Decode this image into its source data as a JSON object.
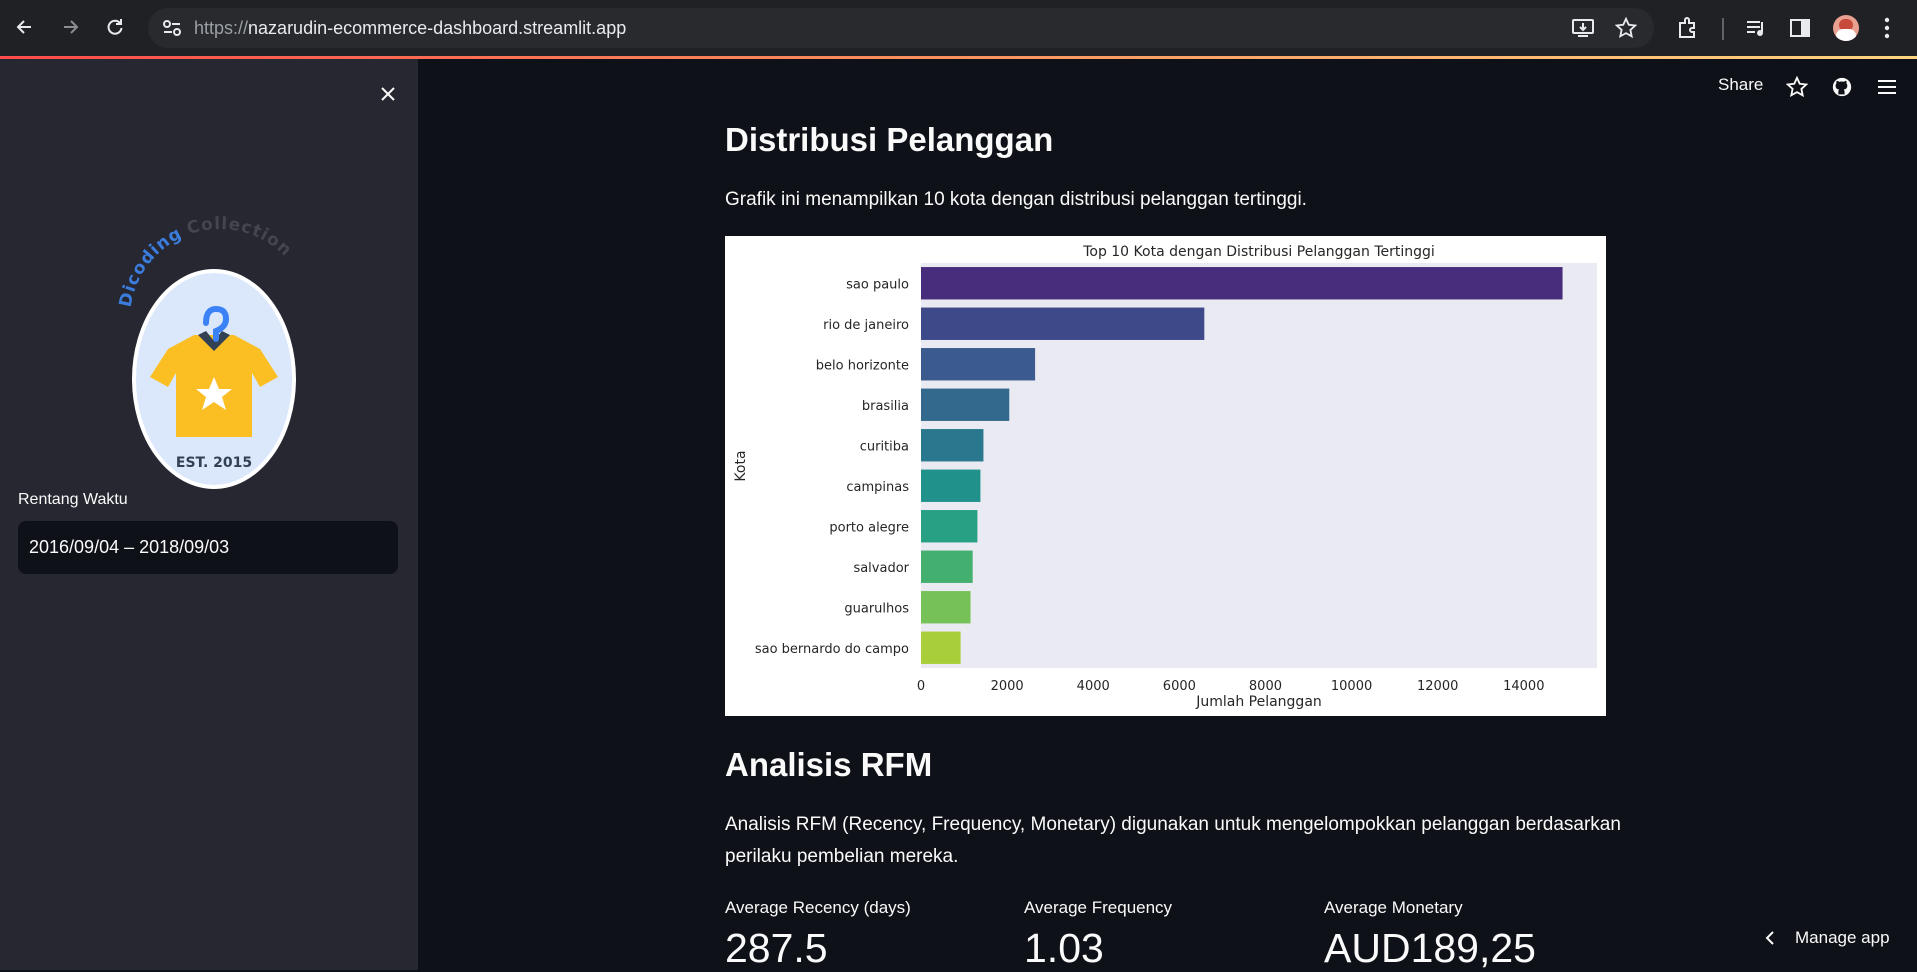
{
  "browser": {
    "url_scheme": "https://",
    "url_host": "nazarudin-ecommerce-dashboard.streamlit.app"
  },
  "sidebar": {
    "logo": {
      "arc_left": "Dicoding",
      "arc_right": "Collection",
      "est": "EST. 2015"
    },
    "date_label": "Rentang Waktu",
    "date_value": "2016/09/04 – 2018/09/03"
  },
  "header": {
    "share_label": "Share"
  },
  "section1": {
    "title": "Distribusi Pelanggan",
    "description": "Grafik ini menampilkan 10 kota dengan distribusi pelanggan tertinggi."
  },
  "chart_data": {
    "type": "bar",
    "orientation": "horizontal",
    "title": "Top 10 Kota dengan Distribusi Pelanggan Tertinggi",
    "xlabel": "Jumlah Pelanggan",
    "ylabel": "Kota",
    "categories": [
      "sao paulo",
      "rio de janeiro",
      "belo horizonte",
      "brasilia",
      "curitiba",
      "campinas",
      "porto alegre",
      "salvador",
      "guarulhos",
      "sao bernardo do campo"
    ],
    "values": [
      14900,
      6580,
      2650,
      2050,
      1450,
      1380,
      1310,
      1200,
      1150,
      920
    ],
    "xlim": [
      0,
      15700
    ],
    "xticks": [
      0,
      2000,
      4000,
      6000,
      8000,
      10000,
      12000,
      14000
    ],
    "colors": [
      "#472d7b",
      "#3e4989",
      "#3b5a8e",
      "#33698d",
      "#2a788e",
      "#21918c",
      "#27a083",
      "#44b06f",
      "#77c258",
      "#a8cf3a"
    ],
    "plot_background": "#eaeaf2",
    "grid": false
  },
  "section2": {
    "title": "Analisis RFM",
    "description_line1": "Analisis RFM (Recency, Frequency, Monetary) digunakan untuk mengelompokkan pelanggan berdasarkan",
    "description_line2": "perilaku pembelian mereka."
  },
  "metrics": [
    {
      "label": "Average Recency (days)",
      "value": "287.5"
    },
    {
      "label": "Average Frequency",
      "value": "1.03"
    },
    {
      "label": "Average Monetary",
      "value": "AUD189,25"
    }
  ],
  "footer": {
    "manage_app": "Manage app"
  }
}
